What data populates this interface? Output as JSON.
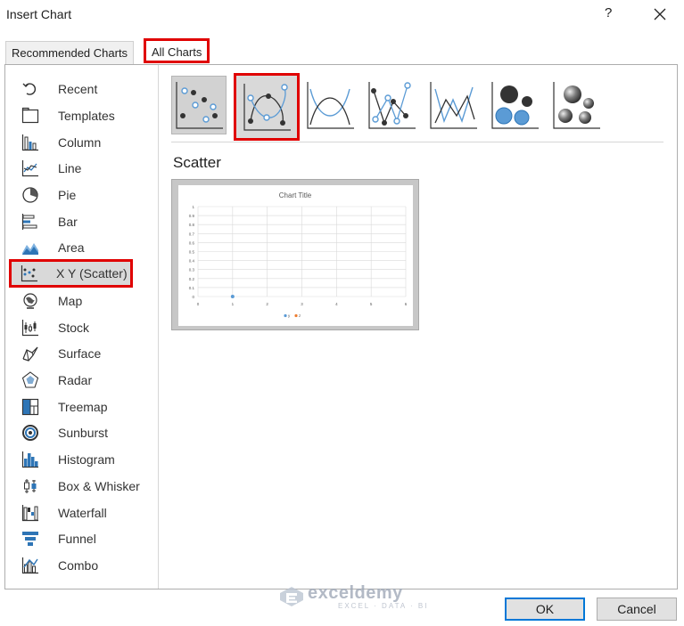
{
  "window": {
    "title": "Insert Chart",
    "help": "?",
    "close": "×"
  },
  "tabs": [
    {
      "label": "Recommended Charts",
      "active": false
    },
    {
      "label": "All Charts",
      "active": true
    }
  ],
  "sidebar": {
    "items": [
      {
        "label": "Recent",
        "icon": "recent-icon"
      },
      {
        "label": "Templates",
        "icon": "templates-icon"
      },
      {
        "label": "Column",
        "icon": "column-chart-icon"
      },
      {
        "label": "Line",
        "icon": "line-chart-icon"
      },
      {
        "label": "Pie",
        "icon": "pie-chart-icon"
      },
      {
        "label": "Bar",
        "icon": "bar-chart-icon"
      },
      {
        "label": "Area",
        "icon": "area-chart-icon"
      },
      {
        "label": "X Y (Scatter)",
        "icon": "scatter-chart-icon",
        "selected": true
      },
      {
        "label": "Map",
        "icon": "map-chart-icon"
      },
      {
        "label": "Stock",
        "icon": "stock-chart-icon"
      },
      {
        "label": "Surface",
        "icon": "surface-chart-icon"
      },
      {
        "label": "Radar",
        "icon": "radar-chart-icon"
      },
      {
        "label": "Treemap",
        "icon": "treemap-chart-icon"
      },
      {
        "label": "Sunburst",
        "icon": "sunburst-chart-icon"
      },
      {
        "label": "Histogram",
        "icon": "histogram-chart-icon"
      },
      {
        "label": "Box & Whisker",
        "icon": "box-whisker-chart-icon"
      },
      {
        "label": "Waterfall",
        "icon": "waterfall-chart-icon"
      },
      {
        "label": "Funnel",
        "icon": "funnel-chart-icon"
      },
      {
        "label": "Combo",
        "icon": "combo-chart-icon"
      }
    ]
  },
  "main": {
    "section_title": "Scatter",
    "subtypes": [
      {
        "icon": "scatter-markers-icon",
        "selected": true
      },
      {
        "icon": "scatter-smooth-lines-markers-icon",
        "highlighted": true
      },
      {
        "icon": "scatter-smooth-lines-icon"
      },
      {
        "icon": "scatter-straight-lines-markers-icon"
      },
      {
        "icon": "scatter-straight-lines-icon"
      },
      {
        "icon": "bubble-icon"
      },
      {
        "icon": "3d-bubble-icon"
      }
    ],
    "preview": {
      "title": "Chart Title",
      "y_ticks": [
        "1",
        "0.9",
        "0.8",
        "0.7",
        "0.6",
        "0.5",
        "0.4",
        "0.3",
        "0.2",
        "0.1",
        "0"
      ],
      "x_ticks": [
        "0",
        "1",
        "2",
        "3",
        "4",
        "5",
        "6"
      ],
      "legend": [
        "y",
        "z"
      ]
    }
  },
  "footer": {
    "ok": "OK",
    "cancel": "Cancel"
  },
  "watermark": {
    "name": "exceldemy",
    "tagline": "EXCEL · DATA · BI"
  },
  "colors": {
    "selection_outline": "#e00000",
    "accent_blue": "#0078d7",
    "chart_blue": "#5b9bd5"
  }
}
